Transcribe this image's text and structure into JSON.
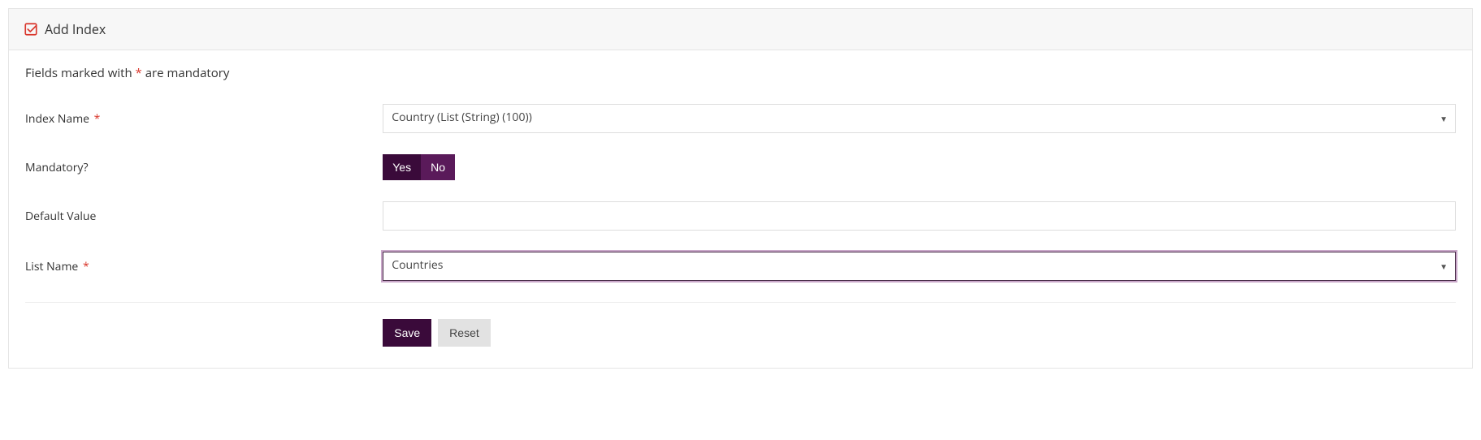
{
  "header": {
    "title": "Add Index"
  },
  "notice": {
    "prefix": "Fields marked with ",
    "asterisk": "*",
    "suffix": " are mandatory"
  },
  "form": {
    "indexName": {
      "label": "Index Name",
      "required": "*",
      "value": "Country (List (String) (100))"
    },
    "mandatory": {
      "label": "Mandatory?",
      "yes": "Yes",
      "no": "No"
    },
    "defaultValue": {
      "label": "Default Value",
      "value": ""
    },
    "listName": {
      "label": "List Name",
      "required": "*",
      "value": "Countries"
    }
  },
  "buttons": {
    "save": "Save",
    "reset": "Reset"
  }
}
